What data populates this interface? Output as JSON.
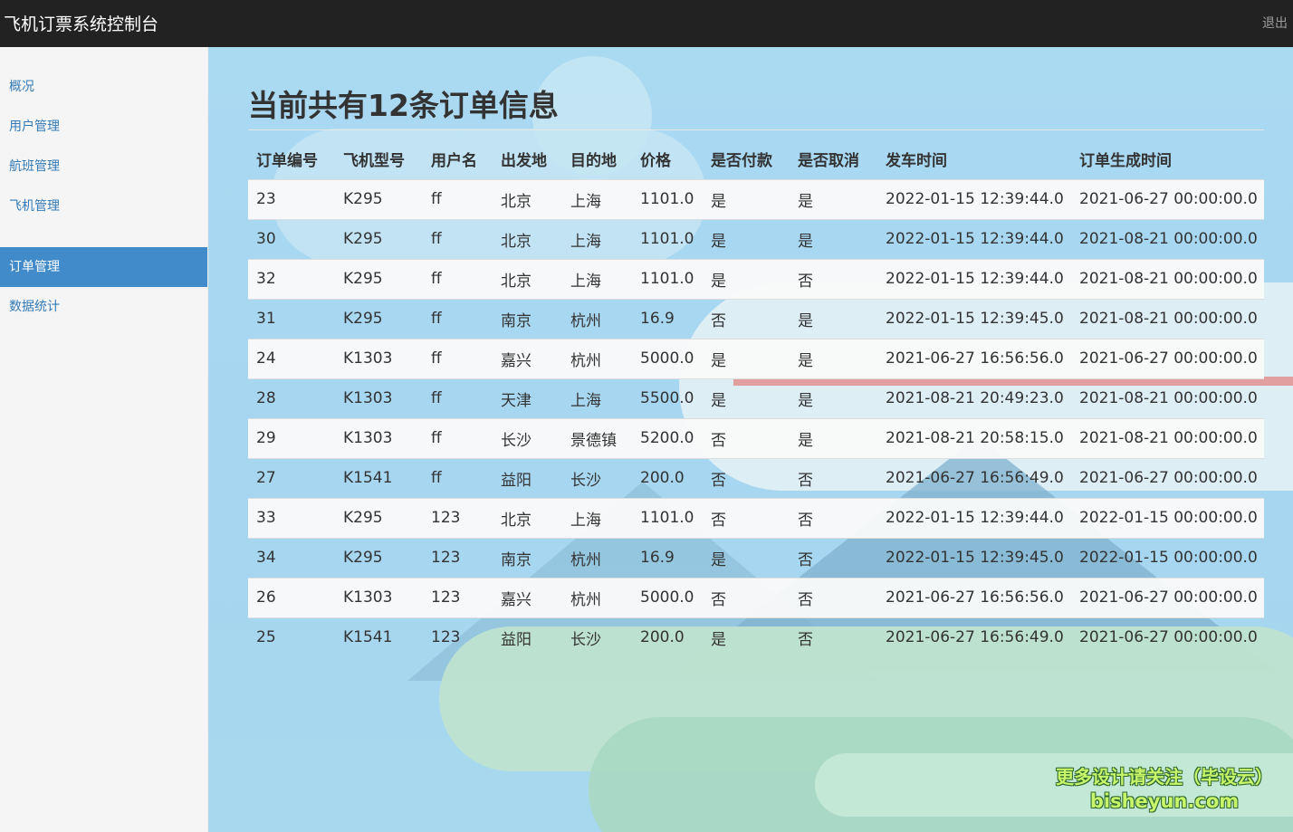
{
  "header": {
    "brand": "飞机订票系统控制台",
    "logout": "退出"
  },
  "sidebar": {
    "items": [
      {
        "label": "概况",
        "active": false
      },
      {
        "label": "用户管理",
        "active": false
      },
      {
        "label": "航班管理",
        "active": false
      },
      {
        "label": "飞机管理",
        "active": false
      },
      {
        "label": "订单管理",
        "active": true
      },
      {
        "label": "数据统计",
        "active": false
      }
    ]
  },
  "main": {
    "title": "当前共有12条订单信息",
    "columns": [
      "订单编号",
      "飞机型号",
      "用户名",
      "出发地",
      "目的地",
      "价格",
      "是否付款",
      "是否取消",
      "发车时间",
      "订单生成时间"
    ],
    "rows": [
      [
        "23",
        "K295",
        "ff",
        "北京",
        "上海",
        "1101.0",
        "是",
        "是",
        "2022-01-15 12:39:44.0",
        "2021-06-27 00:00:00.0"
      ],
      [
        "30",
        "K295",
        "ff",
        "北京",
        "上海",
        "1101.0",
        "是",
        "是",
        "2022-01-15 12:39:44.0",
        "2021-08-21 00:00:00.0"
      ],
      [
        "32",
        "K295",
        "ff",
        "北京",
        "上海",
        "1101.0",
        "是",
        "否",
        "2022-01-15 12:39:44.0",
        "2021-08-21 00:00:00.0"
      ],
      [
        "31",
        "K295",
        "ff",
        "南京",
        "杭州",
        "16.9",
        "否",
        "是",
        "2022-01-15 12:39:45.0",
        "2021-08-21 00:00:00.0"
      ],
      [
        "24",
        "K1303",
        "ff",
        "嘉兴",
        "杭州",
        "5000.0",
        "是",
        "是",
        "2021-06-27 16:56:56.0",
        "2021-06-27 00:00:00.0"
      ],
      [
        "28",
        "K1303",
        "ff",
        "天津",
        "上海",
        "5500.0",
        "是",
        "是",
        "2021-08-21 20:49:23.0",
        "2021-08-21 00:00:00.0"
      ],
      [
        "29",
        "K1303",
        "ff",
        "长沙",
        "景德镇",
        "5200.0",
        "否",
        "是",
        "2021-08-21 20:58:15.0",
        "2021-08-21 00:00:00.0"
      ],
      [
        "27",
        "K1541",
        "ff",
        "益阳",
        "长沙",
        "200.0",
        "否",
        "否",
        "2021-06-27 16:56:49.0",
        "2021-06-27 00:00:00.0"
      ],
      [
        "33",
        "K295",
        "123",
        "北京",
        "上海",
        "1101.0",
        "否",
        "否",
        "2022-01-15 12:39:44.0",
        "2022-01-15 00:00:00.0"
      ],
      [
        "34",
        "K295",
        "123",
        "南京",
        "杭州",
        "16.9",
        "是",
        "否",
        "2022-01-15 12:39:45.0",
        "2022-01-15 00:00:00.0"
      ],
      [
        "26",
        "K1303",
        "123",
        "嘉兴",
        "杭州",
        "5000.0",
        "否",
        "否",
        "2021-06-27 16:56:56.0",
        "2021-06-27 00:00:00.0"
      ],
      [
        "25",
        "K1541",
        "123",
        "益阳",
        "长沙",
        "200.0",
        "是",
        "否",
        "2021-06-27 16:56:49.0",
        "2021-06-27 00:00:00.0"
      ]
    ]
  },
  "watermark": {
    "line1": "更多设计请关注（毕设云）",
    "line2": "bisheyun.com"
  },
  "colors": {
    "topbar": "#222222",
    "accent": "#428bca",
    "link": "#337ab7"
  }
}
